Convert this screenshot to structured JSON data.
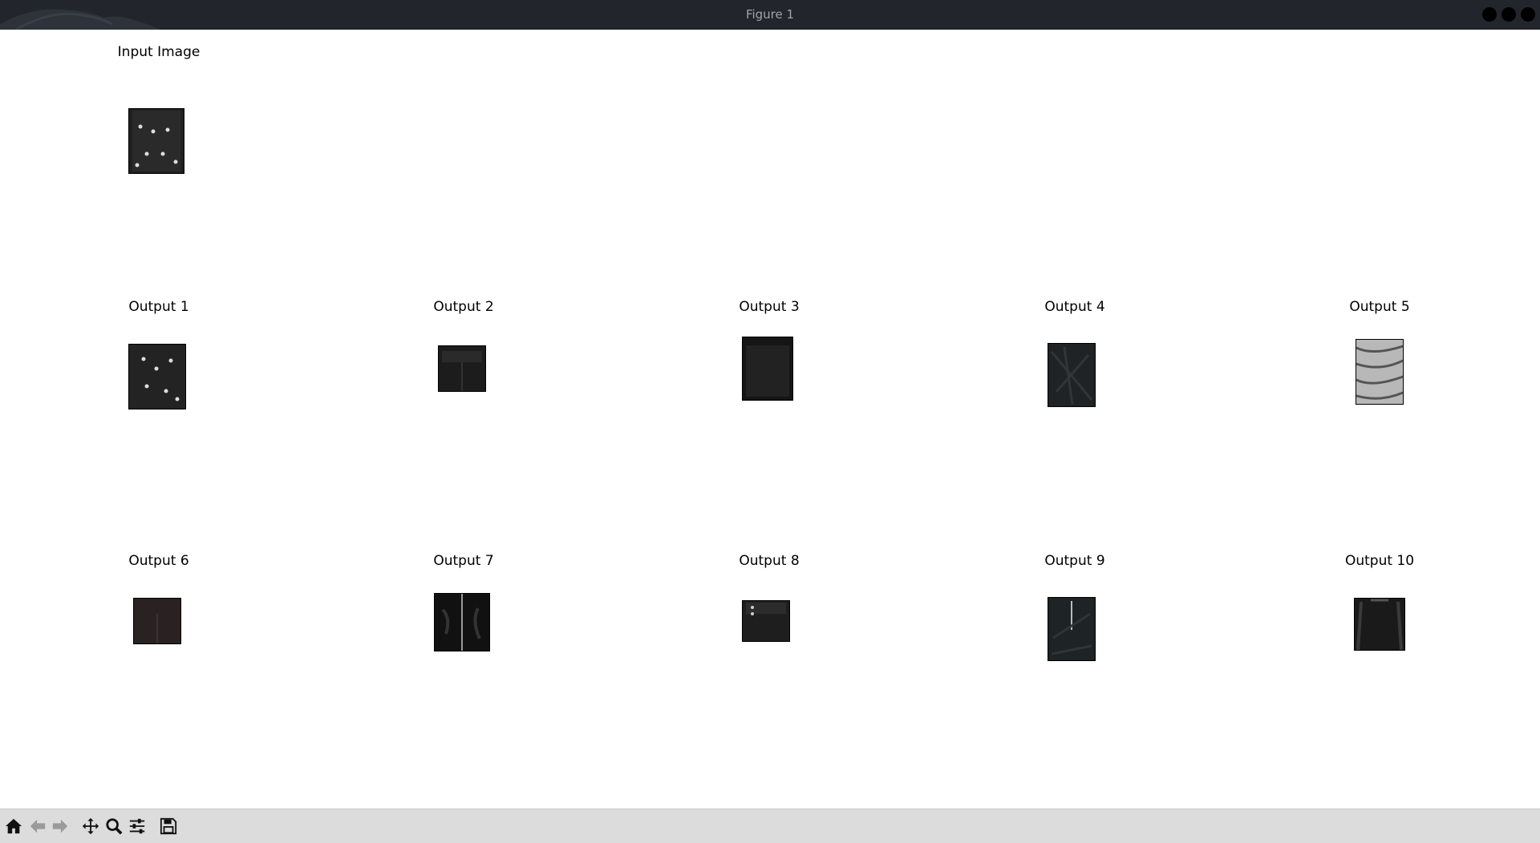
{
  "window": {
    "title": "Figure 1"
  },
  "figure": {
    "input": {
      "label": "Input Image"
    },
    "outputs": [
      {
        "label": "Output 1"
      },
      {
        "label": "Output 2"
      },
      {
        "label": "Output 3"
      },
      {
        "label": "Output 4"
      },
      {
        "label": "Output 5"
      },
      {
        "label": "Output 6"
      },
      {
        "label": "Output 7"
      },
      {
        "label": "Output 8"
      },
      {
        "label": "Output 9"
      },
      {
        "label": "Output 10"
      }
    ]
  },
  "toolbar": {
    "buttons": [
      {
        "icon": "home-icon"
      },
      {
        "icon": "back-arrow-icon"
      },
      {
        "icon": "forward-arrow-icon"
      },
      {
        "icon": "pan-move-icon"
      },
      {
        "icon": "zoom-magnifier-icon"
      },
      {
        "icon": "configure-subplots-icon"
      },
      {
        "icon": "save-floppy-icon"
      }
    ]
  }
}
